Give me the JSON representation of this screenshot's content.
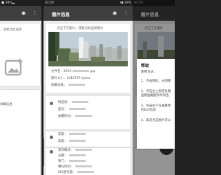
{
  "screen1": {
    "status_left": "■ 39%▂",
    "hint_text": "、或者点此选择",
    "detail_text": "详细信息"
  },
  "screen2": {
    "status_time": "02:24",
    "status_right": "▾▮ 39%",
    "title": "图片信息",
    "hint_text": "点击下方图片，或者点此选择图片",
    "file": {
      "label": "文件名：2019",
      "suffix": ".jpg"
    },
    "size": {
      "label": "图片大小：1416797 bytes"
    },
    "device": {
      "label": "拍摄设备："
    },
    "meta1": [
      "制造商：",
      "型号：",
      "拍摄时间："
    ],
    "meta2": [
      "宽度：",
      "高度："
    ],
    "meta3": [
      "景深模式：",
      "光圈：",
      "快门：",
      "曝光时间：",
      "ISO感光度："
    ]
  },
  "screen3": {
    "status_time": "02:24",
    "title": "图片信息",
    "hint_text": "点击下方图片",
    "dialog": {
      "title": "帮助",
      "subtitle": "使用方法：",
      "step1": "1、点击图标，从图库",
      "step2a": "2、点击右上角定位图",
      "step2b": "查看拍摄图片时的位",
      "step3a": "3、点击右下方查看更",
      "step3b": "的Exif信息",
      "step4": "4、再次点击图片可以"
    }
  }
}
